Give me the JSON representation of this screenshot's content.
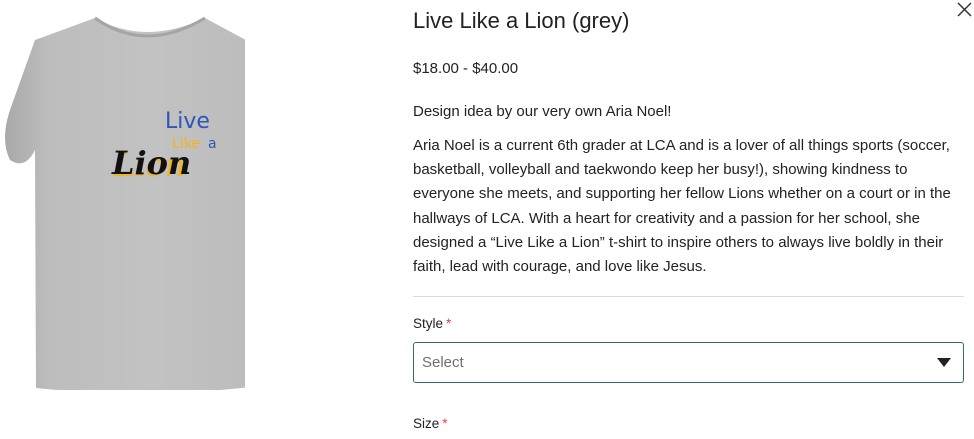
{
  "product": {
    "title": "Live Like a Lion (grey)",
    "price": "$18.00 - $40.00",
    "description_lead": "Design idea by our very own Aria Noel!",
    "description_body": "Aria Noel is a current 6th grader at LCA and is a lover of all things sports (soccer, basketball, volleyball and taekwondo keep her busy!), showing kindness to everyone she meets, and supporting her fellow Lions whether on a court or in the hallways of LCA. With a heart for creativity and a passion for her school, she designed a “Live Like a Lion” t-shirt to inspire others to always live boldly in their faith, lead with courage, and love like Jesus."
  },
  "shirt_graphic": {
    "word1": "Live",
    "word2": "Like",
    "word3": "a",
    "word4": "Lion",
    "shirt_color": "#b9b9b9",
    "blue": "#2f55b5",
    "gold": "#f2b51c",
    "black": "#111111"
  },
  "options": {
    "style_label": "Style",
    "style_required": "*",
    "style_placeholder": "Select",
    "size_label": "Size",
    "size_required": "*"
  },
  "colors": {
    "select_border": "#2f6e6e",
    "required_star": "#e0443a"
  },
  "icons": {
    "close": "close-icon",
    "dropdown": "chevron-down-icon"
  }
}
